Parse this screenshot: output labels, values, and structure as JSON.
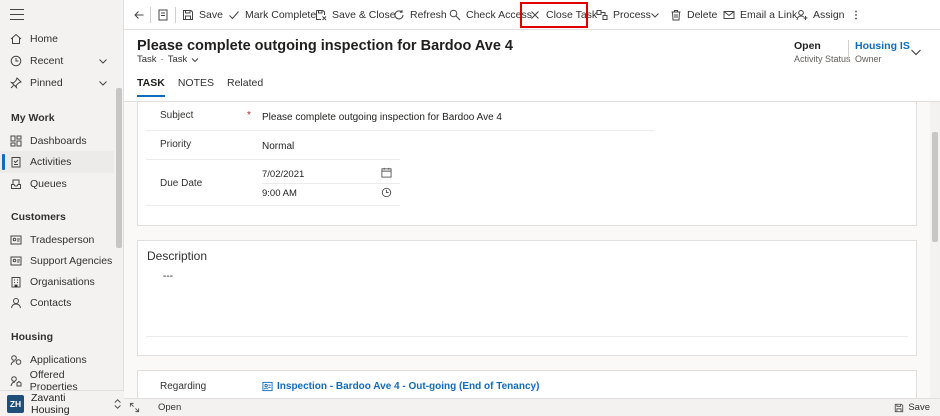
{
  "sidebar": {
    "items": [
      {
        "label": "Home",
        "icon": "home-icon"
      },
      {
        "label": "Recent",
        "icon": "clock-icon"
      },
      {
        "label": "Pinned",
        "icon": "pin-icon"
      }
    ],
    "sections": [
      {
        "title": "My Work",
        "items": [
          {
            "label": "Dashboards",
            "icon": "dashboard-icon"
          },
          {
            "label": "Activities",
            "icon": "activities-icon",
            "active": true
          },
          {
            "label": "Queues",
            "icon": "queue-icon"
          }
        ]
      },
      {
        "title": "Customers",
        "items": [
          {
            "label": "Tradesperson",
            "icon": "contact-card-icon"
          },
          {
            "label": "Support Agencies",
            "icon": "contact-card-icon"
          },
          {
            "label": "Organisations",
            "icon": "building-icon"
          },
          {
            "label": "Contacts",
            "icon": "person-icon"
          }
        ]
      },
      {
        "title": "Housing",
        "items": [
          {
            "label": "Applications",
            "icon": "applications-icon"
          },
          {
            "label": "Offered Properties",
            "icon": "property-icon"
          }
        ]
      }
    ],
    "area": {
      "badge": "ZH",
      "name": "Zavanti Housing"
    }
  },
  "commandbar": {
    "save": "Save",
    "mark_complete": "Mark Complete",
    "save_close": "Save & Close",
    "refresh": "Refresh",
    "check_access": "Check Access",
    "close_task": "Close Task",
    "process": "Process",
    "delete": "Delete",
    "email_link": "Email a Link",
    "assign": "Assign"
  },
  "header": {
    "title": "Please complete outgoing inspection for Bardoo Ave 4",
    "entity": "Task",
    "form": "Task",
    "status_value": "Open",
    "status_label": "Activity Status",
    "owner_value": "Housing IS",
    "owner_label": "Owner",
    "tabs": [
      "TASK",
      "NOTES",
      "Related"
    ]
  },
  "form": {
    "subject_label": "Subject",
    "subject_value": "Please complete outgoing inspection for Bardoo Ave 4",
    "priority_label": "Priority",
    "priority_value": "Normal",
    "due_label": "Due Date",
    "due_date": "7/02/2021",
    "due_time": "9:00 AM",
    "description_title": "Description",
    "description_value": "---",
    "regarding_label": "Regarding",
    "regarding_value": "Inspection - Bardoo Ave 4 - Out-going (End of Tenancy)"
  },
  "statusbar": {
    "status": "Open",
    "save": "Save"
  },
  "colors": {
    "accent": "#0f6cbd",
    "highlight": "#e00000",
    "area_badge": "#1f4e79"
  }
}
